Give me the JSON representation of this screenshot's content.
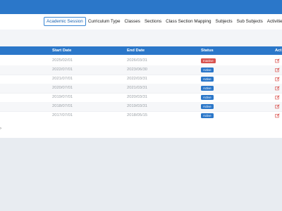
{
  "nav": {
    "tabs": [
      {
        "label": "Academic Session",
        "active": true
      },
      {
        "label": "Curriculum Type",
        "active": false
      },
      {
        "label": "Classes",
        "active": false
      },
      {
        "label": "Sections",
        "active": false
      },
      {
        "label": "Class Section Mapping",
        "active": false
      },
      {
        "label": "Subjects",
        "active": false
      },
      {
        "label": "Sub Subjects",
        "active": false
      },
      {
        "label": "Activities",
        "active": false
      }
    ]
  },
  "table": {
    "headers": {
      "start_date": "Start Date",
      "end_date": "End Date",
      "status": "Status",
      "action": "Act"
    },
    "rows": [
      {
        "start": "2025/02/01",
        "end": "2026/03/31",
        "status": "Inactive",
        "status_color": "#d9534f"
      },
      {
        "start": "2022/07/01",
        "end": "2023/06/30",
        "status": "Active",
        "status_color": "#2b77c9"
      },
      {
        "start": "2021/07/01",
        "end": "2022/03/31",
        "status": "Active",
        "status_color": "#2b77c9"
      },
      {
        "start": "2020/07/01",
        "end": "2021/03/31",
        "status": "Active",
        "status_color": "#2b77c9"
      },
      {
        "start": "2019/07/01",
        "end": "2020/03/31",
        "status": "Active",
        "status_color": "#2b77c9"
      },
      {
        "start": "2018/07/01",
        "end": "2019/03/31",
        "status": "Active",
        "status_color": "#2b77c9"
      },
      {
        "start": "2017/07/01",
        "end": "2018/05/15",
        "status": "Active",
        "status_color": "#2b77c9"
      }
    ]
  },
  "footer": {
    "arrow": "›"
  },
  "colors": {
    "brand": "#2b77c9",
    "inactive": "#d9534f",
    "edit_icon": "#d9534f"
  }
}
